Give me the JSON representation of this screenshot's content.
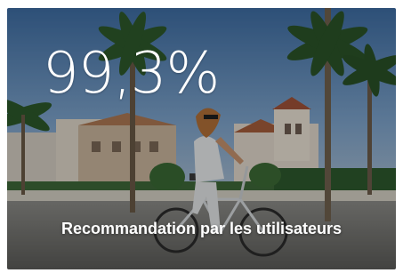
{
  "card": {
    "stat_value": "99,3%",
    "stat_caption": "Recommandation par les utilisateurs"
  },
  "colors": {
    "sky": "#5b86b8",
    "overlay": "#000000",
    "text": "#ffffff"
  }
}
